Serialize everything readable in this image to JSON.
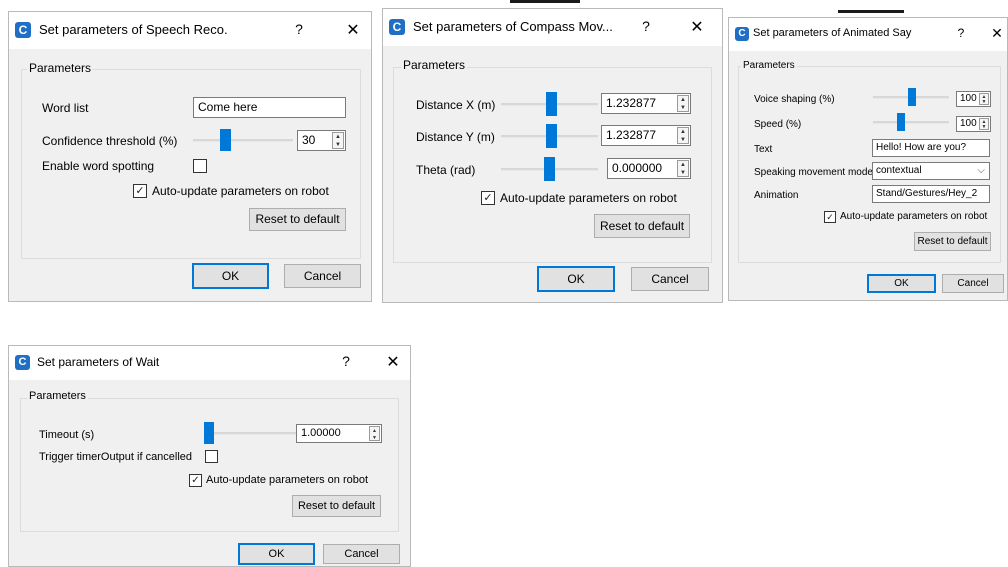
{
  "colors": {
    "accent": "#0078d7",
    "dialog_bg": "#f0f0f0",
    "icon_bg": "#1f6fc5"
  },
  "icons": {
    "app": "app-c-icon",
    "help": "question-mark-icon",
    "close": "close-x-icon",
    "check": "checkmark-icon",
    "spin": "spin-arrows-icon",
    "dropdown": "chevron-down-icon"
  },
  "common": {
    "app_icon_letter": "C",
    "help": "?",
    "close": "✕",
    "group_title": "Parameters",
    "ok": "OK",
    "cancel": "Cancel",
    "reset": "Reset to default",
    "auto_update": "Auto-update parameters on robot",
    "check_mark": "✓",
    "spin_up": "▲",
    "spin_down": "▼",
    "dropdown_arrow": "⌵"
  },
  "speech": {
    "title": "Set parameters of Speech Reco.",
    "word_list_label": "Word list",
    "word_list_value": "Come here",
    "confidence_label": "Confidence threshold (%)",
    "confidence_value": "30",
    "confidence_level": 0.3,
    "word_spotting_label": "Enable word spotting",
    "word_spotting_checked": false,
    "auto_update_checked": true
  },
  "compass": {
    "title": "Set parameters of Compass Mov...",
    "distance_x_label": "Distance X (m)",
    "distance_x_value": "1.232877",
    "distance_y_label": "Distance Y (m)",
    "distance_y_value": "1.232877",
    "theta_label": "Theta (rad)",
    "theta_value": "0.000000",
    "auto_update_checked": true
  },
  "animated": {
    "title": "Set parameters of Animated Say",
    "voice_label": "Voice shaping (%)",
    "voice_value": "100",
    "speed_label": "Speed (%)",
    "speed_value": "100",
    "text_label": "Text",
    "text_value": "Hello! How are you?",
    "mode_label": "Speaking movement mode",
    "mode_value": "contextual",
    "animation_label": "Animation",
    "animation_value": "Stand/Gestures/Hey_2",
    "auto_update_checked": true
  },
  "wait": {
    "title": "Set parameters of Wait",
    "timeout_label": "Timeout (s)",
    "timeout_value": "1.00000",
    "trigger_label": "Trigger timerOutput if cancelled",
    "trigger_checked": false,
    "auto_update_checked": true
  }
}
